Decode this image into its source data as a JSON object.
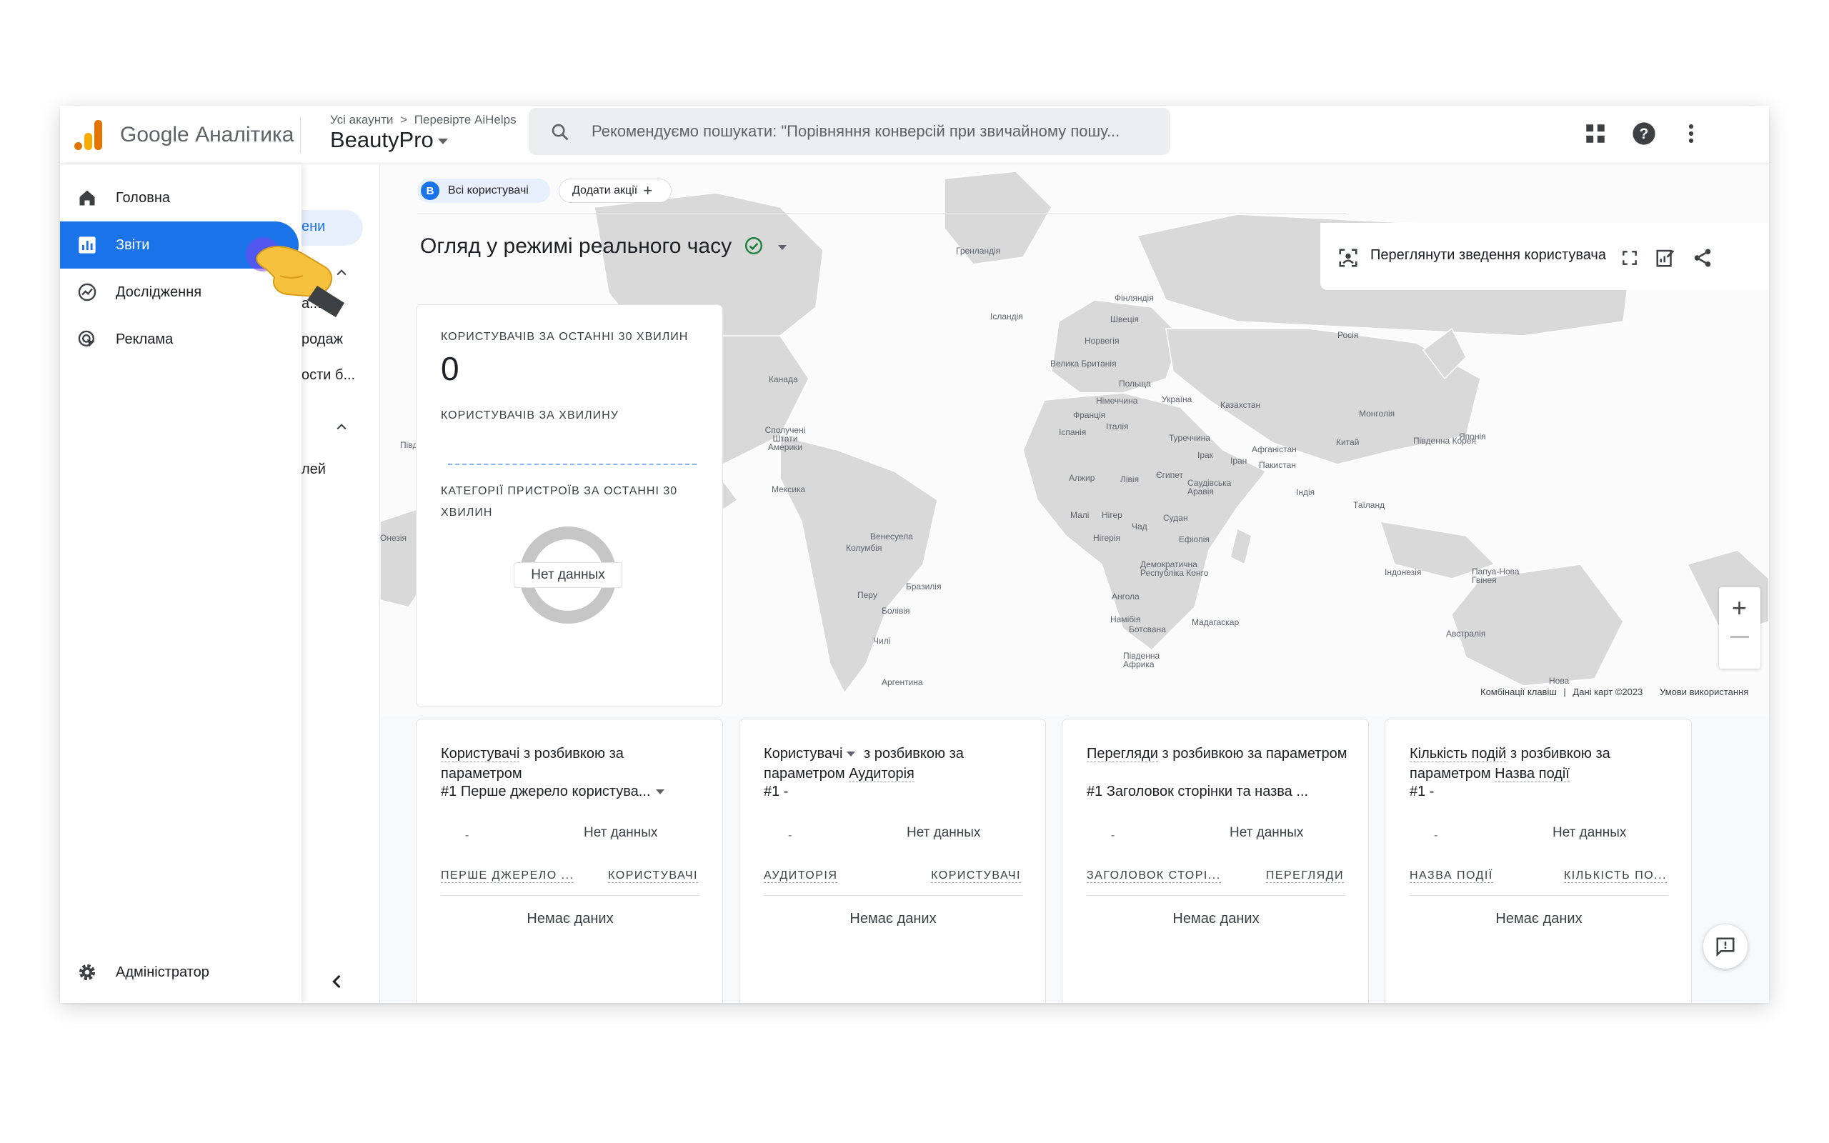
{
  "app": {
    "name": "Google Аналітика"
  },
  "breadcrumb": {
    "all_accounts": "Усі акаунти",
    "account": "Перевірте AiHelps"
  },
  "property": {
    "name": "BeautyPro"
  },
  "search": {
    "placeholder": "Рекомендуємо пошукати: \"Порівняння конверсій при звичайному пошу..."
  },
  "nav": {
    "items": [
      {
        "label": "Головна",
        "icon": "home-icon"
      },
      {
        "label": "Звіти",
        "icon": "reports-icon",
        "active": true
      },
      {
        "label": "Дослідження",
        "icon": "explore-icon"
      },
      {
        "label": "Реклама",
        "icon": "advertising-icon"
      }
    ],
    "admin": "Адміністратор"
  },
  "subnav": {
    "fragments": [
      "ени",
      "а...",
      "родаж",
      "ости б...",
      "лей"
    ]
  },
  "filters": {
    "segment_badge": "B",
    "segment": "Всі користувачі",
    "add_comparison": "Додати акції"
  },
  "page": {
    "title": "Огляд у режимі реального часу",
    "user_snapshot": "Переглянути зведення користувача"
  },
  "realtime_card": {
    "users_30min_caption": "КОРИСТУВАЧІВ ЗА ОСТАННІ 30 ХВИЛИН",
    "users_30min": "0",
    "users_per_min_caption": "КОРИСТУВАЧІВ ЗА ХВИЛИНУ",
    "device_caption_l1": "КАТЕГОРІЇ ПРИСТРОЇВ ЗА ОСТАННІ 30",
    "device_caption_l2": "ХВИЛИН",
    "no_data": "Нет данных"
  },
  "map": {
    "labels": [
      "Гренландія",
      "Ісландія",
      "Фінляндія",
      "Швеція",
      "Норвегія",
      "Росія",
      "Велика Британія",
      "Польща",
      "Україна",
      "Німеччина",
      "Казахстан",
      "Монголія",
      "Франція",
      "Італія",
      "Іспанія",
      "Туреччина",
      "Китай",
      "Південна Корея",
      "Японія",
      "Ірак",
      "Іран",
      "Афганістан",
      "Пакистан",
      "Канада",
      "Сполучені Штати Америки",
      "Мексика",
      "Алжир",
      "Лівія",
      "Єгипет",
      "Саудівська Аравія",
      "Індія",
      "Таїланд",
      "Малі",
      "Нігер",
      "Чад",
      "Судан",
      "Нігерія",
      "Ефіопія",
      "Венесуела",
      "Колумбія",
      "Перу",
      "Бразилія",
      "Болівія",
      "Чилі",
      "Аргентина",
      "Демократична Республіка Конго",
      "Ангола",
      "Намібія",
      "Ботсвана",
      "Мадагаскар",
      "Південна Африка",
      "Індонезія",
      "Папуа-Нова Гвінея",
      "Австралія",
      "Нова",
      "Південна",
      "Онезія"
    ],
    "attribution": {
      "shortcuts": "Комбінації клавіш",
      "data": "Дані карт ©2023",
      "terms": "Умови використання"
    }
  },
  "cards": [
    {
      "title_a": "Користувачі",
      "title_b": " з розбивкою за параметром",
      "rank": "#1",
      "dimension": "Перше джерело користува...",
      "no_data_chart": "Нет данных",
      "col1": "ПЕРШЕ ДЖЕРЕЛО ...",
      "col2": "КОРИСТУВАЧІ",
      "empty": "Немає даних"
    },
    {
      "title_a": "Користувачі",
      "title_b": " з розбивкою за параметром",
      "rank": "#1  -",
      "dimension": "Аудиторія",
      "no_data_chart": "Нет данных",
      "col1": "АУДИТОРІЯ",
      "col2": "КОРИСТУВАЧІ",
      "empty": "Немає даних"
    },
    {
      "title_a": "Перегляди",
      "title_b": " з розбивкою за параметром",
      "rank": "#1",
      "dimension": "Заголовок сторінки та назва ...",
      "no_data_chart": "Нет данных",
      "col1": "ЗАГОЛОВОК СТОРІ...",
      "col2": "ПЕРЕГЛЯДИ",
      "empty": "Немає даних"
    },
    {
      "title_a": "Кількість подій",
      "title_b": " з розбивкою за параметром",
      "rank": "#1  -",
      "dimension": "Назва події",
      "no_data_chart": "Нет данных",
      "col1": "НАЗВА ПОДІЇ",
      "col2": "КІЛЬКІСТЬ ПО...",
      "empty": "Немає даних"
    }
  ],
  "colors": {
    "accent": "#1a73e8",
    "logo_orange": "#f9ab00",
    "logo_dark": "#e37400"
  }
}
